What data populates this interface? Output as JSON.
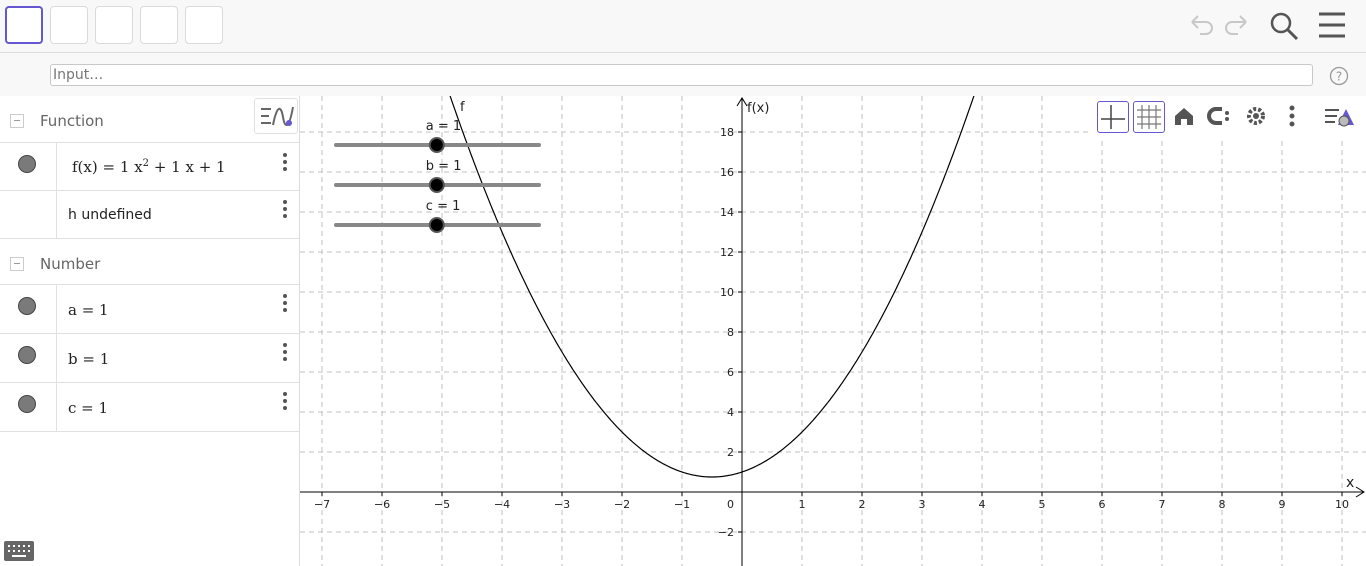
{
  "toolbar": {
    "tools": [
      "tool-move",
      "tool-point",
      "tool-line",
      "tool-circle",
      "tool-polygon"
    ]
  },
  "input": {
    "placeholder": "Input…"
  },
  "algebra": {
    "group_function": "Function",
    "group_number": "Number",
    "function_expr": {
      "lhs": "f(x)",
      "eq": "=",
      "c2": "1",
      "var": "x",
      "exp": "2",
      "rest": "+ 1 x + 1"
    },
    "h_text": "h undefined",
    "numbers": [
      "a = 1",
      "b = 1",
      "c = 1"
    ]
  },
  "graphics": {
    "sliders": [
      {
        "name": "a",
        "label": "a = 1",
        "value": 1
      },
      {
        "name": "b",
        "label": "b = 1",
        "value": 1
      },
      {
        "name": "c",
        "label": "c = 1",
        "value": 1
      }
    ],
    "x_axis_label": "x",
    "y_axis_label": "f(x)",
    "curve_label": "f",
    "origin_label": "0",
    "x_ticks": [
      -7,
      -6,
      -5,
      -4,
      -3,
      -2,
      -1,
      1,
      2,
      3,
      4,
      5,
      6,
      7,
      8,
      9,
      10
    ],
    "y_ticks": [
      -2,
      2,
      4,
      6,
      8,
      10,
      12,
      14,
      16,
      18
    ],
    "x_labels": [
      "−7",
      "−6",
      "−5",
      "−4",
      "−3",
      "−2",
      "−1",
      "1",
      "2",
      "3",
      "4",
      "5",
      "6",
      "7",
      "8",
      "9",
      "10"
    ],
    "y_labels": [
      "−2",
      "2",
      "4",
      "6",
      "8",
      "10",
      "12",
      "14",
      "16",
      "18"
    ],
    "function": {
      "a": 1,
      "b": 1,
      "c": 1
    },
    "colors": {
      "grid": "#c0c0c0",
      "axis": "#000000",
      "curve": "#000000",
      "accent": "#6557d2"
    }
  }
}
